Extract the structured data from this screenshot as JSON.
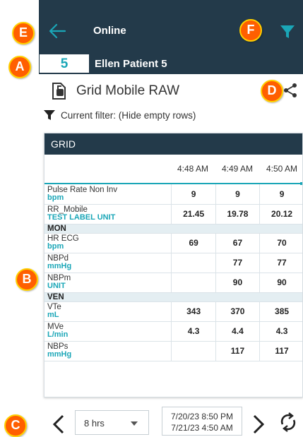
{
  "header": {
    "title": "Online"
  },
  "patient": {
    "bed": "5",
    "name": "Ellen Patient 5"
  },
  "page": {
    "title": "Grid Mobile RAW"
  },
  "filter": {
    "label": "Current filter:",
    "value": "(Hide empty rows)"
  },
  "grid": {
    "title": "GRID",
    "times": [
      "4:48 AM",
      "4:49 AM",
      "4:50 AM"
    ],
    "rows": [
      {
        "type": "data",
        "name": "Pulse Rate Non Inv",
        "unit": "bpm",
        "values": [
          "9",
          "9",
          "9"
        ]
      },
      {
        "type": "data",
        "name": "RR_Mobile",
        "unit": "TEST LABEL UNIT",
        "values": [
          "21.45",
          "19.78",
          "20.12"
        ]
      },
      {
        "type": "group",
        "name": "MON"
      },
      {
        "type": "data",
        "name": "HR ECG",
        "unit": "bpm",
        "values": [
          "69",
          "67",
          "70"
        ]
      },
      {
        "type": "data",
        "name": "NBPd",
        "unit": "mmHg",
        "values": [
          "",
          "77",
          "77"
        ]
      },
      {
        "type": "data",
        "name": "NBPm",
        "unit": "UNIT",
        "values": [
          "",
          "90",
          "90"
        ]
      },
      {
        "type": "group",
        "name": "VEN"
      },
      {
        "type": "data",
        "name": "VTe",
        "unit": "mL",
        "values": [
          "343",
          "370",
          "385"
        ]
      },
      {
        "type": "data",
        "name": "MVe",
        "unit": "L/min",
        "values": [
          "4.3",
          "4.4",
          "4.3"
        ]
      },
      {
        "type": "data",
        "name": "NBPs",
        "unit": "mmHg",
        "values": [
          "",
          "117",
          "117"
        ]
      }
    ]
  },
  "footer": {
    "range": "8 hrs",
    "date_from": "7/20/23 8:50 PM",
    "date_to": "7/21/23 4:50 AM"
  },
  "callouts": {
    "a": "A",
    "b": "B",
    "c": "C",
    "d": "D",
    "e": "E",
    "f": "F"
  },
  "colors": {
    "header_bg": "#233a4a",
    "accent": "#1aa6b7",
    "callout": "#ff5f00",
    "callout_border": "#ffd100",
    "group_bg": "#e4eef2"
  },
  "icons": [
    "back-arrow-icon",
    "filter-icon",
    "document-icon",
    "share-icon",
    "chevron-left-icon",
    "chevron-down-icon",
    "chevron-right-icon",
    "refresh-icon"
  ]
}
